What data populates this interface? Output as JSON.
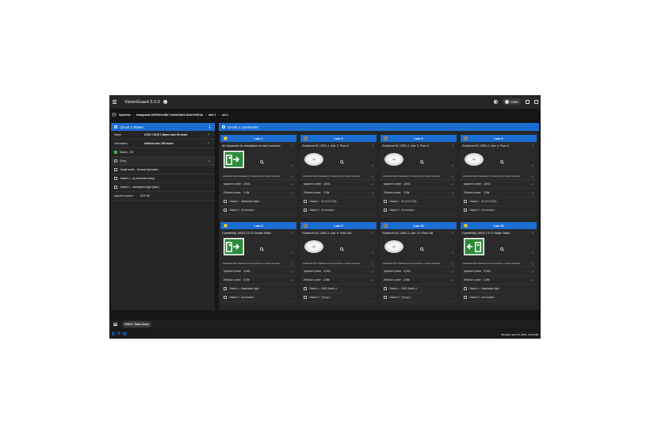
{
  "app": {
    "title": "VisionGuard 3.0.0",
    "user_label": "User"
  },
  "breadcrumb": [
    "Systems",
    "dualguard-b0009eb-08b7-4cbd-9d64-4b3c104f13a",
    "ahd 1",
    "sct 1"
  ],
  "left_panel": {
    "title": "Circuit 1 States",
    "name_label": "Name",
    "name_value": "AT32 1 SCH 1 Name max 40 chars",
    "info_label": "Information",
    "info_value": "Infotext max 100 chars",
    "status_text": "Status - OK",
    "error_text": "Error",
    "items": [
      "Detail mode - Normal Operation",
      "Switch 1 - by luminaire setup",
      "Switch 2 - Maintained light (fast.)"
    ],
    "power_label": "Apparent power",
    "power_value": "53,0 VA",
    "status_color": "#4caf50"
  },
  "right_panel": {
    "title": "Circuit 1 Luminaires",
    "cards": [
      {
        "title": "Lum 1",
        "desc": "40 characters for description of each luminaire",
        "img": "exit-sign",
        "sq": "#f2e000",
        "add": "Additional 100 characters for description of each luminaire",
        "app_label": "Apparent power",
        "app_val": "2,0VA",
        "eff_label": "Effective power",
        "eff_val": "1.0W",
        "sw1": "Switch 1 - Maintained light",
        "sw2": "Switch 2 - No function"
      },
      {
        "title": "Lum 2",
        "desc": "GuideLed SL 13011.1, Adr. 2, Floor 4",
        "img": "downlight",
        "sq": "#777777",
        "add": "Additional 100 characters for description of each luminaire",
        "app_label": "Apparent power",
        "app_val": "4,0VA",
        "eff_label": "Effective power",
        "eff_val": "2.0W",
        "sw1": "Switch 1 - S1 at TLS 3/1",
        "sw2": "Switch 2 - No function"
      },
      {
        "title": "Lum 3",
        "desc": "GuideLed SL 13011.1, Adr. 3, Floor 4",
        "img": "downlight",
        "sq": "#777777",
        "add": "Additional 100 characters for description of each luminaire",
        "app_label": "Apparent power",
        "app_val": "4,0VA",
        "eff_label": "Effective power",
        "eff_val": "2.0W",
        "sw1": "Switch 1 - S1 at TLS 3/1",
        "sw2": "Switch 2 - No function"
      },
      {
        "title": "Lum 4",
        "desc": "GuideLed SL 13011.1, Adr. 4, Floor 4",
        "img": "downlight",
        "sq": "#777777",
        "add": "Additional 100 characters for description of each luminaire",
        "app_label": "Apparent power",
        "app_val": "4,0VA",
        "eff_label": "Effective power",
        "eff_val": "2.0W",
        "sw1": "Switch 1 - S1 at TLS 3/1",
        "sw2": "Switch 2 - No function"
      },
      {
        "title": "Lum 6",
        "desc": "CrystalWay 16632 CG-S Double Sided",
        "img": "exit-sign",
        "sq": "#f2e000",
        "add": "Additional 100 characters for description of each luminaire",
        "app_label": "Apparent power",
        "app_val": "4,0VA",
        "eff_label": "Effective power",
        "eff_val": "3.7W",
        "sw1": "Switch 1 - Maintained light",
        "sw2": "Switch 2 - No function"
      },
      {
        "title": "Lum 9",
        "desc": "GuideLed SL 13011.1, Adr. 9, Floor 4/A",
        "img": "downlight",
        "sq": "#777777",
        "add": "Additional 100 characters for description of each luminaire",
        "app_label": "Apparent power",
        "app_val": "4,0VA",
        "eff_label": "Effective power",
        "eff_val": "2.0W",
        "sw1": "Switch 1 - SMS Switch 1",
        "sw2": "Switch 2 - T(oup) 1"
      },
      {
        "title": "Lum 12",
        "desc": "GuideLed SL 13011.1, Adr. 12, Floor 4/A",
        "img": "downlight",
        "sq": "#777777",
        "add": "Additional 100 characters for description of each luminaire",
        "app_label": "Apparent power",
        "app_val": "4,0VA",
        "eff_label": "Effective power",
        "eff_val": "2.0W",
        "sw1": "Switch 1 - SMS Switch 1",
        "sw2": "Switch 2 - T(oup) 1"
      },
      {
        "title": "Lum 20",
        "desc": "CrystalWay 16631 CG-S Single Sided",
        "img": "exit-sign-2",
        "sq": "#f2e000",
        "add": "Additional 100 characters for description of each luminaire",
        "app_label": "Apparent power",
        "app_val": "2,0VA",
        "eff_label": "Effective power",
        "eff_val": "1.0W",
        "sw1": "Switch 1 - Maintained light",
        "sw2": "Switch 2 - No function"
      }
    ]
  },
  "footer": {
    "items_label": "100/17 Total items",
    "logo": "E·T·N",
    "datetime": "Monday, April 12, 2021, 12:30 PM"
  },
  "colors": {
    "accent": "#1a6dd1",
    "ok": "#5cb85c"
  }
}
